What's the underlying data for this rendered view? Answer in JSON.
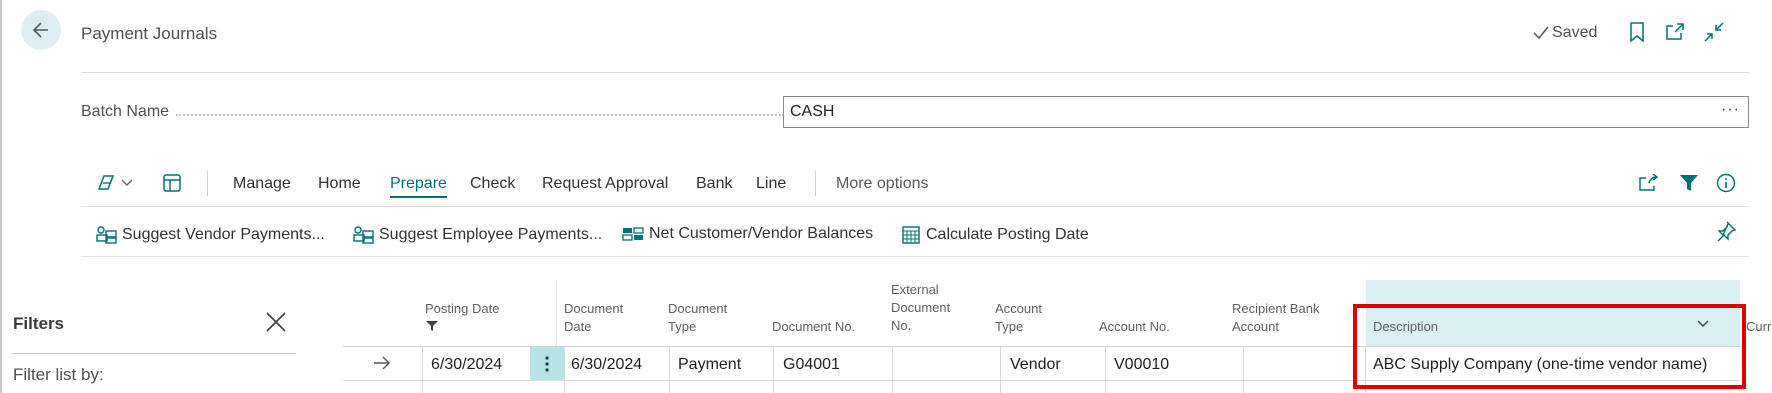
{
  "header": {
    "title": "Payment Journals",
    "saved_label": "Saved"
  },
  "batch": {
    "label": "Batch Name",
    "value": "CASH",
    "ellipsis": "···"
  },
  "actions": {
    "tabs": [
      "Manage",
      "Home",
      "Prepare",
      "Check",
      "Request Approval",
      "Bank",
      "Line"
    ],
    "active_tab": "Prepare",
    "more_options": "More options"
  },
  "promoted": [
    "Suggest Vendor Payments...",
    "Suggest Employee Payments...",
    "Net Customer/Vendor Balances",
    "Calculate Posting Date"
  ],
  "filters": {
    "title": "Filters",
    "filter_list_by": "Filter list by:"
  },
  "columns": {
    "posting_date": "Posting Date",
    "document_date_1": "Document",
    "document_date_2": "Date",
    "document_type_1": "Document",
    "document_type_2": "Type",
    "document_no": "Document No.",
    "external_1": "External",
    "external_2": "Document",
    "external_3": "No.",
    "account_type_1": "Account",
    "account_type_2": "Type",
    "account_no": "Account No.",
    "recipient_1": "Recipient Bank",
    "recipient_2": "Account",
    "description": "Description",
    "currency_partial": "Curr"
  },
  "row": {
    "posting_date": "6/30/2024",
    "document_date": "6/30/2024",
    "document_type": "Payment",
    "document_no": "G04001",
    "external_document_no": "",
    "account_type": "Vendor",
    "account_no": "V00010",
    "recipient_bank_account": "",
    "description": "ABC Supply Company (one-time vendor name)"
  },
  "colors": {
    "accent": "#00707a",
    "highlight_box": "#e10000",
    "description_header_bg": "#d9eff1"
  },
  "icons": [
    "back-arrow-icon",
    "bookmark-icon",
    "open-new-window-icon",
    "collapse-icon",
    "copilot-icon",
    "chevron-down-icon",
    "layout-icon",
    "share-icon",
    "filter-icon",
    "info-icon",
    "pin-icon",
    "close-icon",
    "row-arrow-icon",
    "more-vertical-icon",
    "sort-chevron-icon"
  ]
}
